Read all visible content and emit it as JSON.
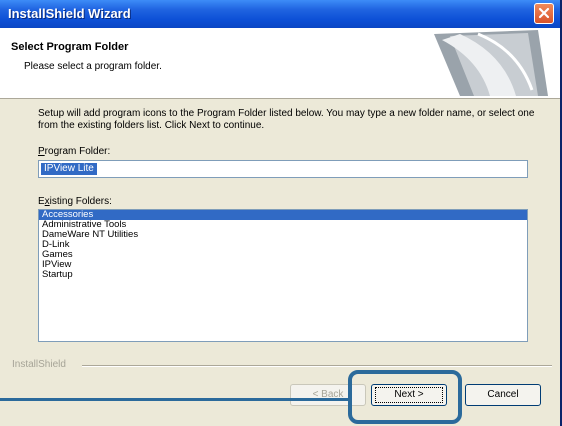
{
  "window": {
    "title": "InstallShield Wizard"
  },
  "header": {
    "title": "Select Program Folder",
    "subtitle": "Please select a program folder."
  },
  "instructions": "Setup will add program icons to the Program Folder listed below.  You may type a new folder name, or select one from the existing folders list.  Click Next to continue.",
  "program_folder": {
    "label_accel": "P",
    "label_rest": "rogram Folder:",
    "value": "IPView Lite"
  },
  "existing_folders": {
    "label_accel": "x",
    "label_pre": "E",
    "label_rest": "isting Folders:",
    "items": [
      "Accessories",
      "Administrative Tools",
      "DameWare NT Utilities",
      "D-Link",
      "Games",
      "IPView",
      "Startup"
    ],
    "selected_index": 0
  },
  "footer": {
    "brand": "InstallShield"
  },
  "buttons": {
    "back": "< Back",
    "next": "Next >",
    "cancel": "Cancel"
  },
  "colors": {
    "title_bar": "#0a46c4",
    "selection": "#316ac5",
    "highlight": "#2b6a9b",
    "dialog_bg": "#ece9d8"
  }
}
